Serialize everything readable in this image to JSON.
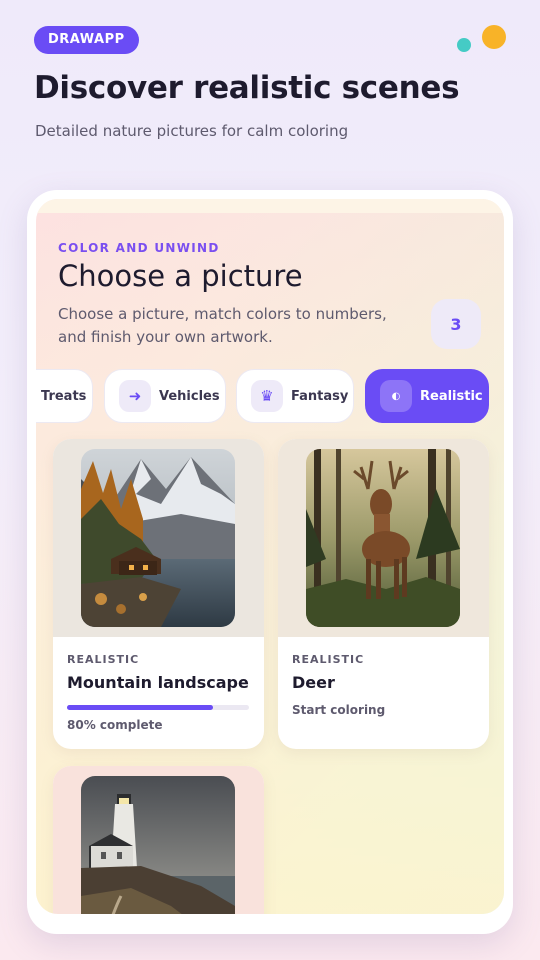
{
  "header": {
    "brand": "DRAWAPP",
    "title": "Discover realistic scenes",
    "subtitle": "Detailed nature pictures for calm coloring"
  },
  "colors": {
    "accent": "#6a4cf5",
    "dot_teal": "#45cbc5",
    "dot_orange": "#f8b328"
  },
  "screen": {
    "eyebrow": "COLOR AND UNWIND",
    "title": "Choose a picture",
    "description": "Choose a picture, match colors to numbers, and finish your own artwork.",
    "count": "3"
  },
  "categories": [
    {
      "label": "Treats",
      "icon": "none",
      "selected": false
    },
    {
      "label": "Vehicles",
      "icon": "arrow-right-icon",
      "selected": false
    },
    {
      "label": "Fantasy",
      "icon": "crown-icon",
      "selected": false
    },
    {
      "label": "Realistic",
      "icon": "half-circle-icon",
      "selected": true
    }
  ],
  "cards": [
    {
      "tag": "REALISTIC",
      "title": "Mountain landscape",
      "status": "80% complete",
      "progress": 0.8,
      "image": "mountain cabin by a lake"
    },
    {
      "tag": "REALISTIC",
      "title": "Deer",
      "status": "Start coloring",
      "image": "red deer stag in forest"
    },
    {
      "tag": "REALISTIC",
      "title": "",
      "status": "",
      "image": "lighthouse on rocky coast"
    }
  ]
}
